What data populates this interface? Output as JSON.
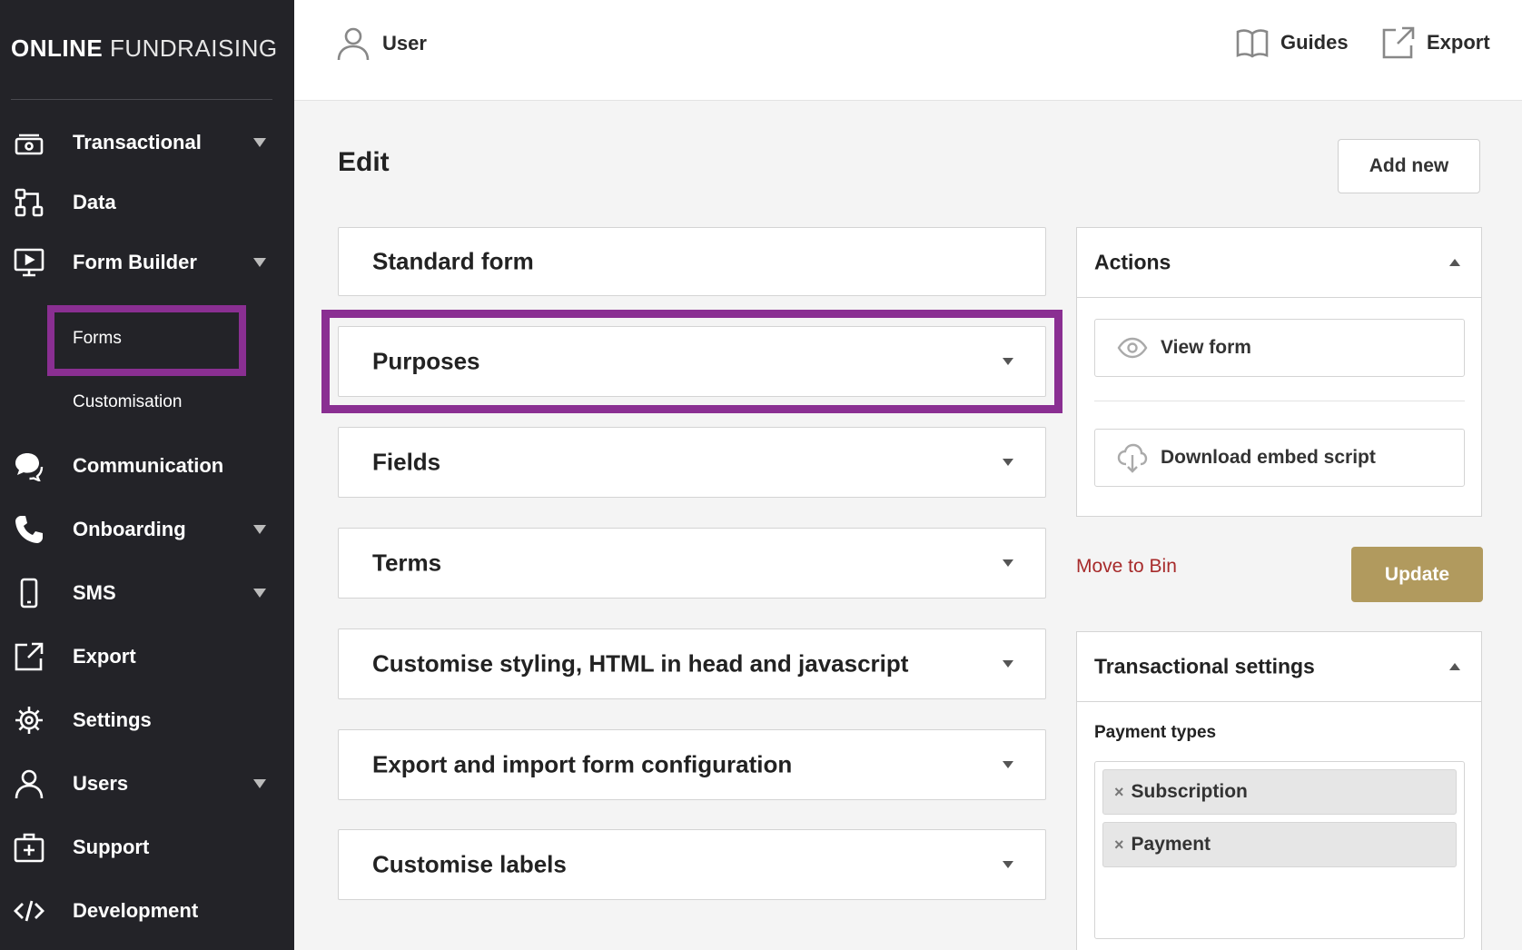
{
  "brand": {
    "bold": "ONLINE",
    "light": "FUNDRAISING"
  },
  "sidebar": {
    "items": [
      {
        "label": "Transactional",
        "icon": "money-icon",
        "has_caret": true
      },
      {
        "label": "Data",
        "icon": "data-flow-icon",
        "has_caret": false
      },
      {
        "label": "Form Builder",
        "icon": "monitor-icon",
        "has_caret": true
      },
      {
        "label": "Communication",
        "icon": "chat-icon",
        "has_caret": false
      },
      {
        "label": "Onboarding",
        "icon": "phone-icon",
        "has_caret": true
      },
      {
        "label": "SMS",
        "icon": "mobile-icon",
        "has_caret": true
      },
      {
        "label": "Export",
        "icon": "export-icon",
        "has_caret": false
      },
      {
        "label": "Settings",
        "icon": "gear-icon",
        "has_caret": false
      },
      {
        "label": "Users",
        "icon": "user-icon",
        "has_caret": true
      },
      {
        "label": "Support",
        "icon": "support-kit-icon",
        "has_caret": false
      },
      {
        "label": "Development",
        "icon": "code-icon",
        "has_caret": false
      }
    ],
    "form_builder_sub": [
      "Forms",
      "Customisation"
    ]
  },
  "topbar": {
    "user_label": "User",
    "guides_label": "Guides",
    "export_label": "Export"
  },
  "main": {
    "title": "Edit",
    "add_new_label": "Add new",
    "panels": [
      "Standard form",
      "Purposes",
      "Fields",
      "Terms",
      "Customise styling, HTML in head and javascript",
      "Export and import form configuration",
      "Customise labels"
    ]
  },
  "actions": {
    "title": "Actions",
    "view_form": "View form",
    "download_embed": "Download embed script",
    "move_to_bin": "Move to Bin",
    "update": "Update"
  },
  "transactional_settings": {
    "title": "Transactional settings",
    "payment_types_label": "Payment types",
    "tags": [
      "Subscription",
      "Payment"
    ]
  },
  "colors": {
    "sidebar_bg": "#232328",
    "highlight": "#8a2f92",
    "update_button": "#b19a5e",
    "danger_link": "#a72b2b"
  }
}
